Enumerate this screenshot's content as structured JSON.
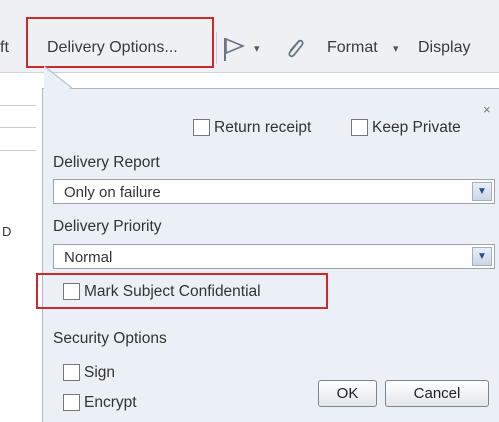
{
  "toolbar": {
    "left_fragment": "ft",
    "delivery_options": "Delivery Options...",
    "caret": "▾",
    "format": "Format",
    "display": "Display"
  },
  "underlying_form": {
    "fragment": "D"
  },
  "popup": {
    "close": "×",
    "return_receipt": "Return receipt",
    "keep_private": "Keep Private",
    "delivery_report_label": "Delivery Report",
    "delivery_report_value": "Only on failure",
    "delivery_priority_label": "Delivery Priority",
    "delivery_priority_value": "Normal",
    "mark_subject_confidential": "Mark Subject Confidential",
    "security_options_label": "Security Options",
    "sign": "Sign",
    "encrypt": "Encrypt",
    "ok": "OK",
    "cancel": "Cancel",
    "dropdown_arrow": "▼"
  },
  "colors": {
    "highlight": "#cc2a2a",
    "popup_bg": "#eaf0f6",
    "toolbar_bg": "#eef0f4"
  }
}
